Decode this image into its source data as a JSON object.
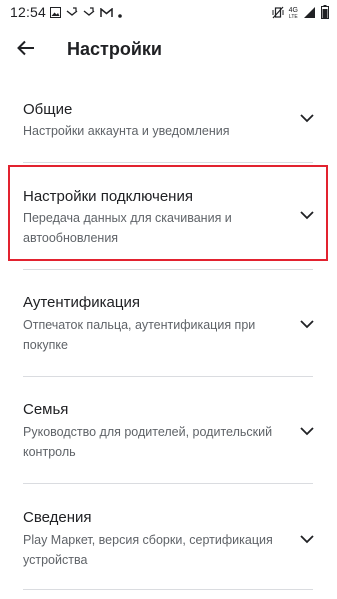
{
  "status_bar": {
    "time": "12:54",
    "network_label_top": "4G",
    "network_label_bottom": "LTE",
    "left_icons": [
      "image-icon",
      "phone-missed-icon",
      "gmail-icon",
      "dot-icon"
    ],
    "right_icons": [
      "vibrate-mute-icon",
      "signal-icon",
      "battery-icon"
    ]
  },
  "app_bar": {
    "title": "Настройки"
  },
  "sections": [
    {
      "title": "Общие",
      "subtitle": "Настройки аккаунта и уведомления"
    },
    {
      "title": "Настройки подключения",
      "subtitle": "Передача данных для скачивания и автообновления"
    },
    {
      "title": "Аутентификация",
      "subtitle": "Отпечаток пальца, аутентификация при покупке"
    },
    {
      "title": "Семья",
      "subtitle": "Руководство для родителей, родительский контроль"
    },
    {
      "title": "Сведения",
      "subtitle": "Play Маркет, версия сборки, сертификация устройства"
    }
  ],
  "colors": {
    "highlight": "#e2222f",
    "text_primary": "#202124",
    "text_secondary": "#5f6368",
    "divider": "#dadce0"
  }
}
